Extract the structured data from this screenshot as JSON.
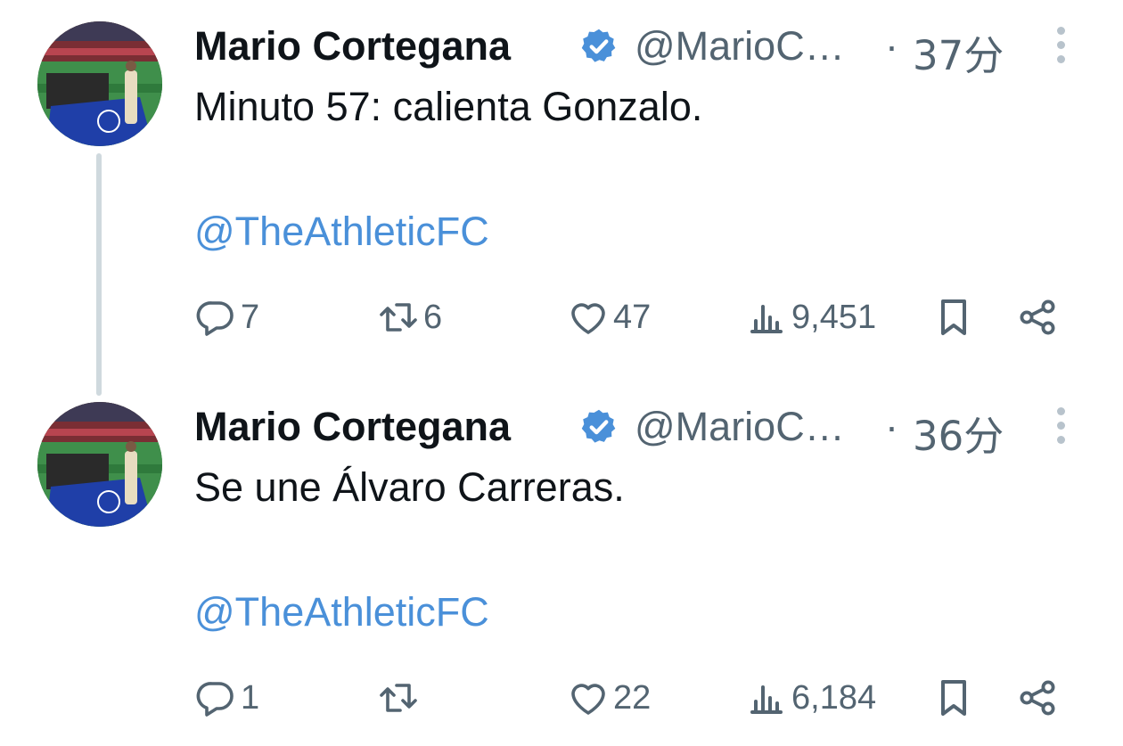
{
  "colors": {
    "accent": "#4a90d9",
    "verified": "#4a90d9",
    "text": "#0f1419",
    "muted": "#536471",
    "thread_line": "#cfd9de"
  },
  "tweets": [
    {
      "author": "Mario Cortegana",
      "handle": "@MarioC…",
      "separator": "·",
      "time": "37分",
      "text": "Minuto 57: calienta Gonzalo.",
      "mention": "@TheAthleticFC",
      "reply_count": "7",
      "retweet_count": "6",
      "like_count": "47",
      "view_count": "9,451",
      "icons": {
        "reply": "reply-icon",
        "retweet": "retweet-icon",
        "like": "heart-icon",
        "views": "views-icon",
        "bookmark": "bookmark-icon",
        "share": "share-icon",
        "more": "more-icon",
        "verified": "verified-badge-icon"
      }
    },
    {
      "author": "Mario Cortegana",
      "handle": "@MarioC…",
      "separator": "·",
      "time": "36分",
      "text": "Se une Álvaro Carreras.",
      "mention": "@TheAthleticFC",
      "reply_count": "1",
      "retweet_count": "",
      "like_count": "22",
      "view_count": "6,184",
      "icons": {
        "reply": "reply-icon",
        "retweet": "retweet-icon",
        "like": "heart-icon",
        "views": "views-icon",
        "bookmark": "bookmark-icon",
        "share": "share-icon",
        "more": "more-icon",
        "verified": "verified-badge-icon"
      }
    }
  ]
}
